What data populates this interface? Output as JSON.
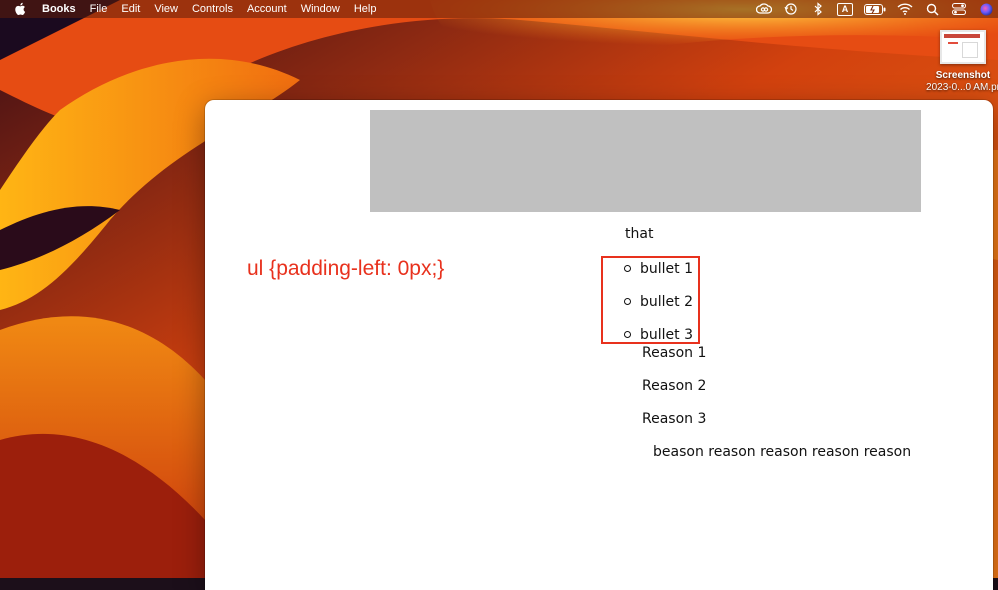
{
  "menubar": {
    "app_name": "Books",
    "items": [
      "File",
      "Edit",
      "View",
      "Controls",
      "Account",
      "Window",
      "Help"
    ],
    "status_icons": [
      "creative-cloud-icon",
      "time-machine-icon",
      "bluetooth-icon",
      "input-source-icon",
      "battery-icon",
      "wifi-icon",
      "spotlight-search-icon",
      "control-center-icon",
      "siri-icon"
    ],
    "input_source_label": "A"
  },
  "desktop": {
    "file_name": "Screenshot",
    "file_subtitle": "2023-0...0 AM.pr"
  },
  "document": {
    "css_annotation": "ul {padding-left: 0px;}",
    "intro_text": "that",
    "bullets": [
      "bullet 1",
      "bullet 2",
      "bullet 3"
    ],
    "reasons": [
      "Reason 1",
      "Reason 2",
      "Reason 3"
    ],
    "trailing_text": "beason reason reason reason reason",
    "annotation_color": "#e8311d",
    "banner_color": "#c0c0c0"
  }
}
